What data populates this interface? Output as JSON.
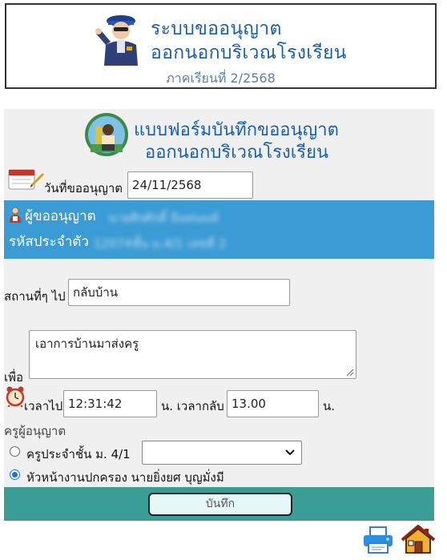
{
  "header": {
    "title_line1": "ระบบขออนุญาต",
    "title_line2": "ออกนอกบริเวณโรงเรียน",
    "term": "ภาคเรียนที่ 2/2568"
  },
  "form": {
    "title_line1": "แบบฟอร์มบันทึกขออนุญาต",
    "title_line2": "ออกนอกบริเวณโรงเรียน",
    "date_label": "วันที่ขออนุญาต",
    "date_value": "24/11/2568",
    "requester_label": "ผู้ขออนุญาต",
    "requester_name": "นายศิรศักดิ์ อินทนนท์",
    "student_id_label": "รหัสประจำตัว",
    "student_id_value": "12074ชั้น ม.4/1 เลขที่ 2",
    "place_label": "สถานที่ๆ ไป",
    "place_value": "กลับบ้าน",
    "purpose_label": "เพื่อ",
    "purpose_value": "เอาการบ้านมาส่งครู",
    "time_out_label": "เวลาไป",
    "time_out_value": "12:31:42",
    "time_unit": "น.",
    "time_back_label": "น. เวลากลับ",
    "time_back_value": "13.00",
    "teacher_label": "ครูผู้อนุญาต",
    "option_homeroom_label": "ครูประจำชั้น ม. 4/1",
    "option_homeroom_select": "",
    "option_head_label": "หัวหน้างานปกครอง นายยิ่งยศ บุญมั่งมี",
    "selected_option": "head",
    "submit_label": "บันทึก"
  },
  "colors": {
    "title_blue": "#1a5fa8",
    "student_band": "#3b9bd4",
    "submit_band": "#3a9e96",
    "radio_accent": "#1a73e8"
  },
  "icons": [
    "guard-icon",
    "student-logo-icon",
    "calendar-icon",
    "person-icon",
    "clock-icon",
    "chevron-down-icon",
    "printer-icon",
    "home-icon"
  ]
}
